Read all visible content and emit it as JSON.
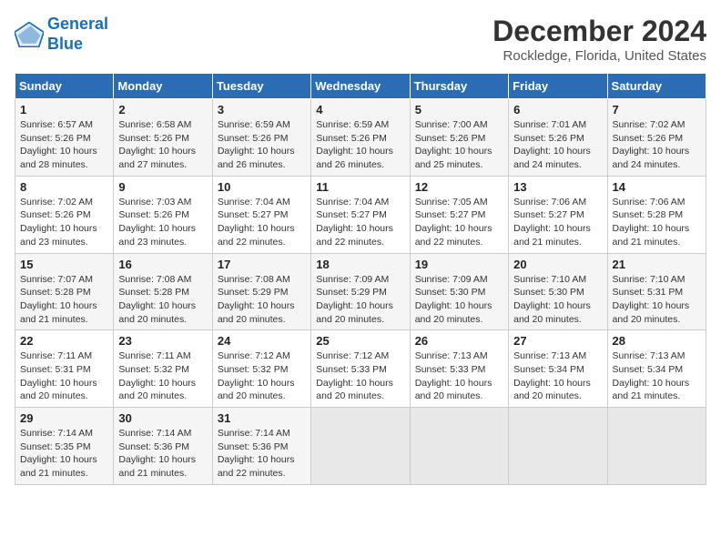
{
  "logo": {
    "line1": "General",
    "line2": "Blue"
  },
  "title": "December 2024",
  "subtitle": "Rockledge, Florida, United States",
  "days_header": [
    "Sunday",
    "Monday",
    "Tuesday",
    "Wednesday",
    "Thursday",
    "Friday",
    "Saturday"
  ],
  "weeks": [
    [
      {
        "day": "1",
        "info": "Sunrise: 6:57 AM\nSunset: 5:26 PM\nDaylight: 10 hours\nand 28 minutes."
      },
      {
        "day": "2",
        "info": "Sunrise: 6:58 AM\nSunset: 5:26 PM\nDaylight: 10 hours\nand 27 minutes."
      },
      {
        "day": "3",
        "info": "Sunrise: 6:59 AM\nSunset: 5:26 PM\nDaylight: 10 hours\nand 26 minutes."
      },
      {
        "day": "4",
        "info": "Sunrise: 6:59 AM\nSunset: 5:26 PM\nDaylight: 10 hours\nand 26 minutes."
      },
      {
        "day": "5",
        "info": "Sunrise: 7:00 AM\nSunset: 5:26 PM\nDaylight: 10 hours\nand 25 minutes."
      },
      {
        "day": "6",
        "info": "Sunrise: 7:01 AM\nSunset: 5:26 PM\nDaylight: 10 hours\nand 24 minutes."
      },
      {
        "day": "7",
        "info": "Sunrise: 7:02 AM\nSunset: 5:26 PM\nDaylight: 10 hours\nand 24 minutes."
      }
    ],
    [
      {
        "day": "8",
        "info": "Sunrise: 7:02 AM\nSunset: 5:26 PM\nDaylight: 10 hours\nand 23 minutes."
      },
      {
        "day": "9",
        "info": "Sunrise: 7:03 AM\nSunset: 5:26 PM\nDaylight: 10 hours\nand 23 minutes."
      },
      {
        "day": "10",
        "info": "Sunrise: 7:04 AM\nSunset: 5:27 PM\nDaylight: 10 hours\nand 22 minutes."
      },
      {
        "day": "11",
        "info": "Sunrise: 7:04 AM\nSunset: 5:27 PM\nDaylight: 10 hours\nand 22 minutes."
      },
      {
        "day": "12",
        "info": "Sunrise: 7:05 AM\nSunset: 5:27 PM\nDaylight: 10 hours\nand 22 minutes."
      },
      {
        "day": "13",
        "info": "Sunrise: 7:06 AM\nSunset: 5:27 PM\nDaylight: 10 hours\nand 21 minutes."
      },
      {
        "day": "14",
        "info": "Sunrise: 7:06 AM\nSunset: 5:28 PM\nDaylight: 10 hours\nand 21 minutes."
      }
    ],
    [
      {
        "day": "15",
        "info": "Sunrise: 7:07 AM\nSunset: 5:28 PM\nDaylight: 10 hours\nand 21 minutes."
      },
      {
        "day": "16",
        "info": "Sunrise: 7:08 AM\nSunset: 5:28 PM\nDaylight: 10 hours\nand 20 minutes."
      },
      {
        "day": "17",
        "info": "Sunrise: 7:08 AM\nSunset: 5:29 PM\nDaylight: 10 hours\nand 20 minutes."
      },
      {
        "day": "18",
        "info": "Sunrise: 7:09 AM\nSunset: 5:29 PM\nDaylight: 10 hours\nand 20 minutes."
      },
      {
        "day": "19",
        "info": "Sunrise: 7:09 AM\nSunset: 5:30 PM\nDaylight: 10 hours\nand 20 minutes."
      },
      {
        "day": "20",
        "info": "Sunrise: 7:10 AM\nSunset: 5:30 PM\nDaylight: 10 hours\nand 20 minutes."
      },
      {
        "day": "21",
        "info": "Sunrise: 7:10 AM\nSunset: 5:31 PM\nDaylight: 10 hours\nand 20 minutes."
      }
    ],
    [
      {
        "day": "22",
        "info": "Sunrise: 7:11 AM\nSunset: 5:31 PM\nDaylight: 10 hours\nand 20 minutes."
      },
      {
        "day": "23",
        "info": "Sunrise: 7:11 AM\nSunset: 5:32 PM\nDaylight: 10 hours\nand 20 minutes."
      },
      {
        "day": "24",
        "info": "Sunrise: 7:12 AM\nSunset: 5:32 PM\nDaylight: 10 hours\nand 20 minutes."
      },
      {
        "day": "25",
        "info": "Sunrise: 7:12 AM\nSunset: 5:33 PM\nDaylight: 10 hours\nand 20 minutes."
      },
      {
        "day": "26",
        "info": "Sunrise: 7:13 AM\nSunset: 5:33 PM\nDaylight: 10 hours\nand 20 minutes."
      },
      {
        "day": "27",
        "info": "Sunrise: 7:13 AM\nSunset: 5:34 PM\nDaylight: 10 hours\nand 20 minutes."
      },
      {
        "day": "28",
        "info": "Sunrise: 7:13 AM\nSunset: 5:34 PM\nDaylight: 10 hours\nand 21 minutes."
      }
    ],
    [
      {
        "day": "29",
        "info": "Sunrise: 7:14 AM\nSunset: 5:35 PM\nDaylight: 10 hours\nand 21 minutes."
      },
      {
        "day": "30",
        "info": "Sunrise: 7:14 AM\nSunset: 5:36 PM\nDaylight: 10 hours\nand 21 minutes."
      },
      {
        "day": "31",
        "info": "Sunrise: 7:14 AM\nSunset: 5:36 PM\nDaylight: 10 hours\nand 22 minutes."
      },
      {
        "day": "",
        "info": ""
      },
      {
        "day": "",
        "info": ""
      },
      {
        "day": "",
        "info": ""
      },
      {
        "day": "",
        "info": ""
      }
    ]
  ]
}
